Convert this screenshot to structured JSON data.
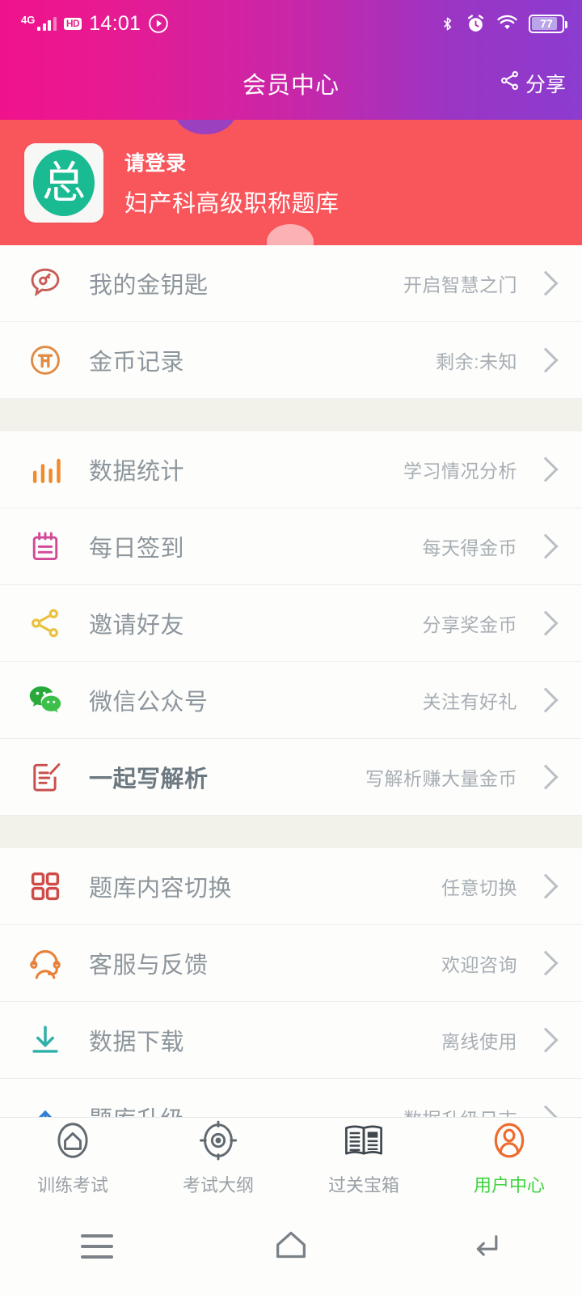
{
  "status_bar": {
    "network_type": "4G",
    "hd_badge": "HD",
    "time": "14:01",
    "play_icon": "play-circle-icon",
    "bluetooth_icon": "bluetooth-icon",
    "alarm_icon": "alarm-clock-icon",
    "wifi_icon": "wifi-icon",
    "battery_level": "77"
  },
  "titlebar": {
    "title": "会员中心",
    "share_label": "分享",
    "share_icon": "share-icon"
  },
  "profile": {
    "logo_glyph": "总",
    "login_prompt": "请登录",
    "bank_name": "妇产科高级职称题库"
  },
  "menu": {
    "groups": [
      {
        "items": [
          {
            "icon": "key-bubble-icon",
            "label": "我的金钥匙",
            "value": "开启智慧之门",
            "emphasis": false
          },
          {
            "icon": "coin-icon",
            "label": "金币记录",
            "value": "剩余:未知",
            "emphasis": false
          }
        ]
      },
      {
        "items": [
          {
            "icon": "bar-chart-icon",
            "label": "数据统计",
            "value": "学习情况分析",
            "emphasis": false
          },
          {
            "icon": "calendar-icon",
            "label": "每日签到",
            "value": "每天得金币",
            "emphasis": false
          },
          {
            "icon": "share-nodes-icon",
            "label": "邀请好友",
            "value": "分享奖金币",
            "emphasis": false
          },
          {
            "icon": "wechat-icon",
            "label": "微信公众号",
            "value": "关注有好礼",
            "emphasis": false
          },
          {
            "icon": "edit-note-icon",
            "label": "一起写解析",
            "value": "写解析赚大量金币",
            "emphasis": true
          }
        ]
      },
      {
        "items": [
          {
            "icon": "grid-icon",
            "label": "题库内容切换",
            "value": "任意切换",
            "emphasis": false
          },
          {
            "icon": "headset-icon",
            "label": "客服与反馈",
            "value": "欢迎咨询",
            "emphasis": false
          },
          {
            "icon": "download-icon",
            "label": "数据下载",
            "value": "离线使用",
            "emphasis": false
          },
          {
            "icon": "upload-icon",
            "label": "题库升级",
            "value": "数据升级日志",
            "emphasis": false
          }
        ]
      }
    ],
    "chevron_icon": "chevron-right-icon"
  },
  "tabbar": {
    "tabs": [
      {
        "icon": "home-shield-icon",
        "label": "训练考试",
        "active": false
      },
      {
        "icon": "target-icon",
        "label": "考试大纲",
        "active": false
      },
      {
        "icon": "newspaper-icon",
        "label": "过关宝箱",
        "active": false
      },
      {
        "icon": "user-profile-icon",
        "label": "用户中心",
        "active": true
      }
    ],
    "active_color": "#3fd43f",
    "active_icon_color": "#ee6a2e"
  },
  "android_nav": {
    "menu_icon": "menu-icon",
    "home_icon": "home-icon",
    "back_icon": "back-icon"
  }
}
